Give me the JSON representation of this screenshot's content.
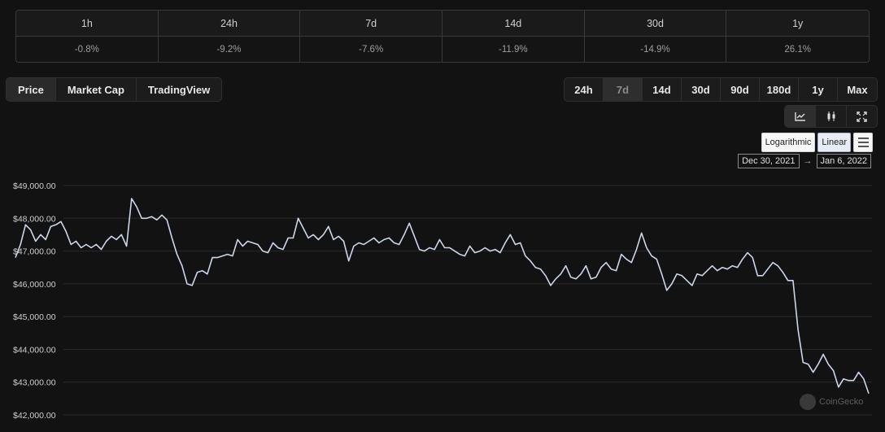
{
  "change_table": {
    "periods": [
      "1h",
      "24h",
      "7d",
      "14d",
      "30d",
      "1y"
    ],
    "values": [
      "-0.8%",
      "-9.2%",
      "-7.6%",
      "-11.9%",
      "-14.9%",
      "26.1%"
    ]
  },
  "view_tabs": [
    "Price",
    "Market Cap",
    "TradingView"
  ],
  "active_view": "Price",
  "range_tabs": [
    "24h",
    "7d",
    "14d",
    "30d",
    "90d",
    "180d",
    "1y",
    "Max"
  ],
  "active_range": "7d",
  "chart_types": [
    "line-chart-icon",
    "candlestick-icon",
    "expand-icon"
  ],
  "scale": {
    "log_label": "Logarithmic",
    "linear_label": "Linear",
    "active": "Linear"
  },
  "date_range": {
    "from": "Dec 30, 2021",
    "arrow": "→",
    "to": "Jan 6, 2022"
  },
  "watermark": "CoinGecko",
  "colors": {
    "background": "#121212",
    "line": "#c9d6ec",
    "grid": "#2a2a2a"
  },
  "chart_data": {
    "type": "line",
    "title": "",
    "xlabel": "",
    "ylabel": "",
    "x_range": [
      "Dec 30, 2021",
      "Jan 6, 2022"
    ],
    "ylim": [
      42000,
      49000
    ],
    "y_ticks": [
      42000,
      43000,
      44000,
      45000,
      46000,
      47000,
      48000,
      49000
    ],
    "y_tick_labels": [
      "$42,000.00",
      "$43,000.00",
      "$44,000.00",
      "$45,000.00",
      "$46,000.00",
      "$47,000.00",
      "$48,000.00",
      "$49,000.00"
    ],
    "grid": true,
    "series": [
      {
        "values": [
          46800,
          47200,
          47800,
          47650,
          47300,
          47500,
          47350,
          47750,
          47800,
          47900,
          47600,
          47200,
          47300,
          47100,
          47200,
          47100,
          47200,
          47050,
          47300,
          47450,
          47350,
          47500,
          47150,
          48600,
          48350,
          48000,
          48000,
          48050,
          47950,
          48100,
          47950,
          47400,
          46900,
          46550,
          46000,
          45950,
          46350,
          46400,
          46300,
          46800,
          46800,
          46850,
          46900,
          46850,
          47350,
          47150,
          47300,
          47250,
          47200,
          47000,
          46950,
          47250,
          47100,
          47050,
          47400,
          47400,
          48000,
          47700,
          47400,
          47500,
          47350,
          47500,
          47750,
          47350,
          47450,
          47300,
          46700,
          47150,
          47250,
          47200,
          47300,
          47400,
          47250,
          47350,
          47400,
          47250,
          47200,
          47500,
          47850,
          47450,
          47050,
          47000,
          47100,
          47050,
          47350,
          47100,
          47100,
          47000,
          46900,
          46850,
          47150,
          46950,
          47000,
          47100,
          47000,
          47050,
          46950,
          47250,
          47500,
          47200,
          47250,
          46850,
          46700,
          46500,
          46450,
          46250,
          45950,
          46150,
          46300,
          46550,
          46200,
          46150,
          46300,
          46550,
          46150,
          46200,
          46500,
          46650,
          46450,
          46400,
          46900,
          46750,
          46650,
          47050,
          47550,
          47100,
          46850,
          46750,
          46300,
          45800,
          46000,
          46300,
          46250,
          46100,
          45950,
          46300,
          46250,
          46400,
          46550,
          46400,
          46500,
          46450,
          46550,
          46500,
          46750,
          46950,
          46800,
          46250,
          46250,
          46450,
          46650,
          46550,
          46350,
          46100,
          46100,
          44600,
          43600,
          43550,
          43300,
          43550,
          43850,
          43550,
          43350,
          42850,
          43100,
          43050,
          43050,
          43300,
          43100,
          42650
        ]
      }
    ]
  }
}
